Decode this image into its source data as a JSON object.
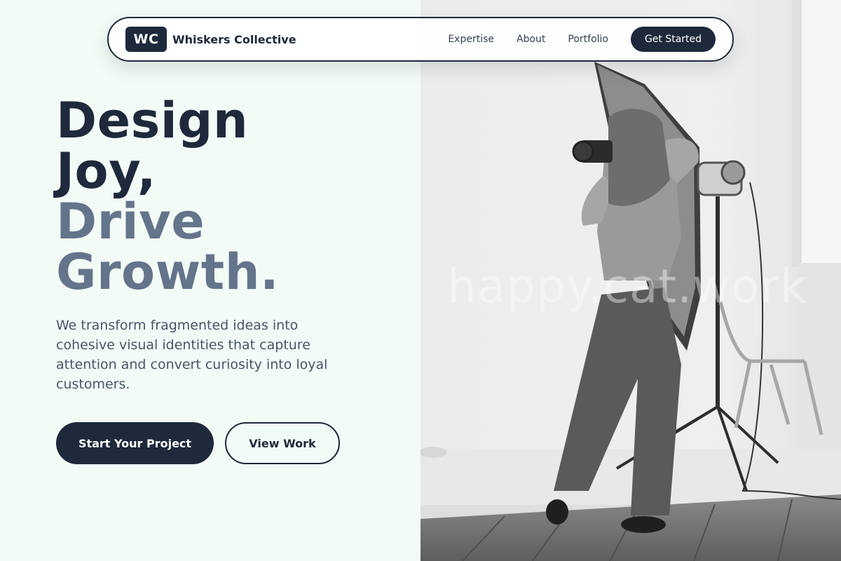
{
  "nav": {
    "logo_text": "WC",
    "brand_name": "Whiskers Collective",
    "links": [
      "Expertise",
      "About",
      "Portfolio"
    ],
    "cta_label": "Get Started"
  },
  "hero": {
    "headline_line1": "Design",
    "headline_line2": "Joy,",
    "headline_line3": "Drive",
    "headline_line4": "Growth.",
    "description": "We transform fragmented ideas into cohesive visual identities that capture attention and convert curiosity into loyal customers.",
    "primary_button": "Start Your Project",
    "secondary_button": "View Work"
  },
  "image": {
    "watermark": "happy.cat.work",
    "subject": "photographer-studio-photo"
  },
  "colors": {
    "primary": "#1e293b",
    "muted_heading": "#64748b",
    "body_text": "#475569",
    "background": "#f3fbf7"
  }
}
